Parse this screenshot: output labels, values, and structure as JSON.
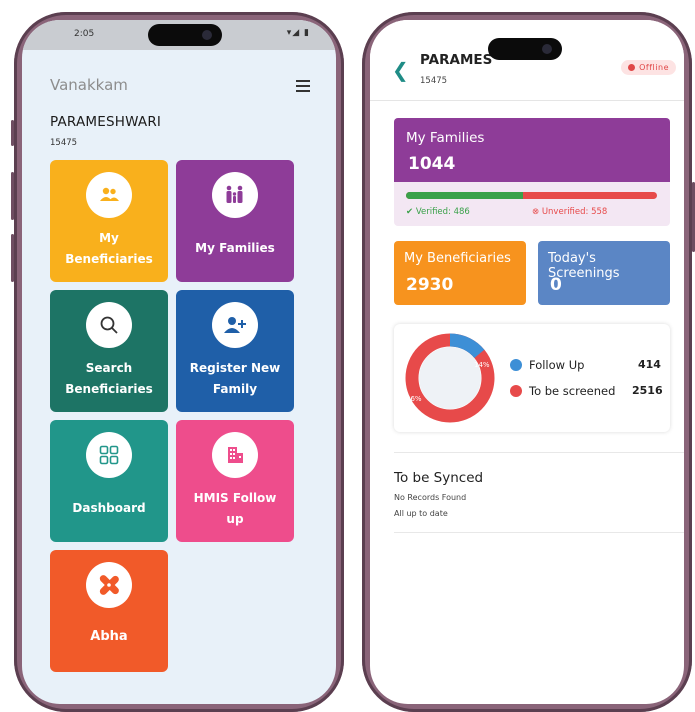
{
  "left": {
    "status": {
      "time": "2:05",
      "icons": "▾◢ ▮"
    },
    "greeting": "Vanakkam",
    "user_name": "PARAMESHWARI",
    "user_id": "15475",
    "tiles": [
      {
        "label_line1": "My",
        "label_line2": "Beneficiaries",
        "color": "#f9b01c",
        "icon": "group-icon"
      },
      {
        "label_line1": "My Families",
        "label_line2": "",
        "color": "#8e3c98",
        "icon": "family-icon"
      },
      {
        "label_line1": "Search",
        "label_line2": "Beneficiaries",
        "color": "#1d7465",
        "icon": "search-icon"
      },
      {
        "label_line1": "Register New",
        "label_line2": "Family",
        "color": "#1f5fa8",
        "icon": "add-person-icon"
      },
      {
        "label_line1": "Dashboard",
        "label_line2": "",
        "color": "#21968a",
        "icon": "grid-icon"
      },
      {
        "label_line1": "HMIS Follow",
        "label_line2": "up",
        "color": "#ee4d8c",
        "icon": "building-icon"
      },
      {
        "label_line1": "Abha",
        "label_line2": "",
        "color": "#f15a29",
        "icon": "bandage-icon"
      }
    ]
  },
  "right": {
    "name": "PARAMES",
    "user_id": "15475",
    "offline_label": "Offline",
    "families": {
      "title": "My Families",
      "count": "1044",
      "verified_label": "Verified: 486",
      "unverified_label": "Unverified: 558",
      "verified_fraction": 0.465
    },
    "beneficiaries": {
      "title": "My Beneficiaries",
      "count": "2930",
      "color": "#f7931e"
    },
    "screenings": {
      "title": "Today's Screenings",
      "count": "0",
      "color": "#5b86c5"
    },
    "donut": {
      "followup_label": "Follow Up",
      "followup_value": "414",
      "followup_pct": "14%",
      "followup_color": "#3d8fd6",
      "screen_label": "To be screened",
      "screen_value": "2516",
      "screen_pct": "86%",
      "screen_color": "#e74a4a",
      "followup_fraction": 0.14
    },
    "sync": {
      "title": "To be Synced",
      "line1": "No Records Found",
      "line2": "All up to date"
    }
  }
}
